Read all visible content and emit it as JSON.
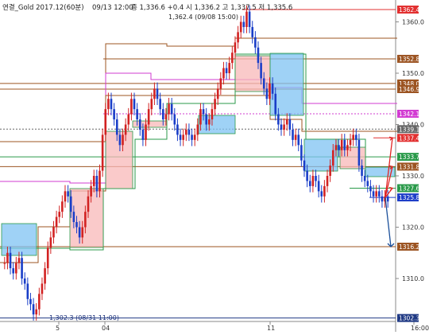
{
  "header": {
    "title": "연결_Gold 2017.12(60분)",
    "datetime": "09/13 12:00",
    "ohlc": "종 1,336.6 +0.4  시 1,336.2  고 1,337.5  저 1,335.6"
  },
  "annotations": {
    "high_note": "1,362.4 (09/08 15:00)",
    "low_note": "1,302.3 (08/31 11:00)"
  },
  "axis": {
    "y_ticks": [
      "1360.0",
      "1350.0",
      "1340.0",
      "1330.0",
      "1320.0",
      "1310.0"
    ],
    "x_ticks": [
      "5",
      "04",
      "11",
      "16:00"
    ]
  },
  "price_tags": [
    {
      "label": "1362.4",
      "kind": "red"
    },
    {
      "label": "1352.8",
      "kind": "brown"
    },
    {
      "label": "1348.0",
      "kind": "brown"
    },
    {
      "label": "1346.9",
      "kind": "brown"
    },
    {
      "label": "1342.1",
      "kind": "magenta"
    },
    {
      "label": "1339.1",
      "kind": "gray"
    },
    {
      "label": "1337.4",
      "kind": "red"
    },
    {
      "label": "1333.7",
      "kind": "green"
    },
    {
      "label": "1331.8",
      "kind": "brown"
    },
    {
      "label": "1327.6",
      "kind": "green"
    },
    {
      "label": "1325.8",
      "kind": "blue"
    },
    {
      "label": "1316.2",
      "kind": "brown"
    },
    {
      "label": "1302.3",
      "kind": "navy"
    }
  ],
  "colors": {
    "red": "#e23030",
    "brown": "#9c5422",
    "magenta": "#d23bd2",
    "green": "#2a9a4a",
    "blue": "#1e3ec8",
    "navy": "#203a84",
    "gray": "#666666",
    "cloud_blue": "#7fc3f3",
    "cloud_pink": "#f8b8b8"
  },
  "chart_data": {
    "type": "candlestick",
    "title": "연결_Gold 2017.12(60분)",
    "ylim": [
      1300,
      1366
    ],
    "x_labels": [
      "5",
      "04",
      "11",
      "16:00"
    ],
    "horizontal_levels": [
      1362.4,
      1352.8,
      1348.0,
      1346.9,
      1342.1,
      1339.1,
      1337.4,
      1333.7,
      1331.8,
      1327.6,
      1325.8,
      1316.2,
      1302.3
    ],
    "projection_arrows": {
      "from": 1325.8,
      "targets_up": [
        1337.4,
        1331.8,
        1327.6
      ],
      "target_down": 1316.2
    },
    "price_path": [
      1313,
      1315,
      1312,
      1311,
      1313,
      1314,
      1310,
      1309,
      1306,
      1305,
      1303,
      1304,
      1307,
      1309,
      1312,
      1316,
      1318,
      1320,
      1322,
      1323,
      1325,
      1327,
      1326,
      1323,
      1321,
      1320,
      1318,
      1320,
      1323,
      1326,
      1328,
      1330,
      1327,
      1331,
      1338,
      1343,
      1345,
      1343,
      1341,
      1338,
      1336,
      1338,
      1340,
      1342,
      1345,
      1343,
      1341,
      1339,
      1337,
      1340,
      1343,
      1345,
      1347,
      1345,
      1343,
      1341,
      1342,
      1344,
      1342,
      1340,
      1338,
      1337,
      1338,
      1339,
      1338,
      1337,
      1338,
      1340,
      1343,
      1342,
      1340,
      1341,
      1343,
      1345,
      1347,
      1349,
      1351,
      1350,
      1352,
      1354,
      1356,
      1358,
      1360,
      1359,
      1362,
      1359,
      1357,
      1355,
      1352,
      1349,
      1347,
      1345,
      1348,
      1346,
      1342,
      1340,
      1339,
      1340,
      1341,
      1339,
      1337,
      1338,
      1336,
      1333,
      1331,
      1329,
      1328,
      1330,
      1329,
      1327,
      1326,
      1328,
      1330,
      1332,
      1335,
      1336,
      1335,
      1337,
      1335,
      1336,
      1337,
      1338,
      1337,
      1332,
      1330,
      1329,
      1328,
      1327,
      1326,
      1327,
      1326,
      1325,
      1326,
      1325
    ]
  }
}
